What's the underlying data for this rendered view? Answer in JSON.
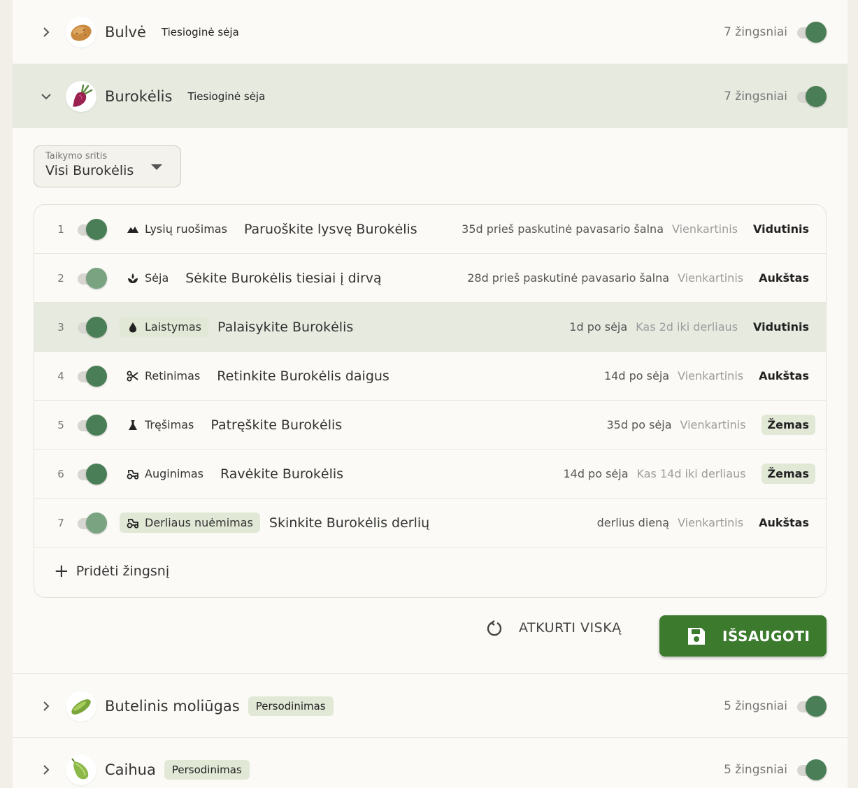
{
  "crops": [
    {
      "name": "Bulvė",
      "method": "Tiesioginė sėja",
      "steps_count": "7 žingsniai",
      "enabled": true,
      "icon": "potato-icon"
    },
    {
      "name": "Burokėlis",
      "method": "Tiesioginė sėja",
      "steps_count": "7 žingsniai",
      "enabled": true,
      "icon": "beet-icon"
    },
    {
      "name": "Butelinis moliūgas",
      "method": "Persodinimas",
      "steps_count": "5 žingsniai",
      "enabled": true,
      "icon": "bottle-gourd-icon"
    },
    {
      "name": "Caihua",
      "method": "Persodinimas",
      "steps_count": "5 žingsniai",
      "enabled": true,
      "icon": "caihua-icon"
    }
  ],
  "scope": {
    "label": "Taikymo sritis",
    "value": "Visi Burokėlis"
  },
  "steps": [
    {
      "num": "1",
      "category": "Lysių ruošimas",
      "icon": "bed-prep-icon",
      "task": "Paruoškite lysvę Burokėlis",
      "timing": "35d prieš paskutinė pavasario šalna",
      "frequency": "Vienkartinis",
      "priority": "Vidutinis"
    },
    {
      "num": "2",
      "category": "Sėja",
      "icon": "seedling-icon",
      "task": "Sėkite Burokėlis tiesiai į dirvą",
      "timing": "28d prieš paskutinė pavasario šalna",
      "frequency": "Vienkartinis",
      "priority": "Aukštas"
    },
    {
      "num": "3",
      "category": "Laistymas",
      "icon": "water-drop-icon",
      "task": "Palaisykite Burokėlis",
      "timing": "1d po sėja",
      "frequency": "Kas 2d iki derliaus",
      "priority": "Vidutinis"
    },
    {
      "num": "4",
      "category": "Retinimas",
      "icon": "scissors-icon",
      "task": "Retinkite Burokėlis daigus",
      "timing": "14d po sėja",
      "frequency": "Vienkartinis",
      "priority": "Aukštas"
    },
    {
      "num": "5",
      "category": "Tręšimas",
      "icon": "flask-icon",
      "task": "Patręškite Burokėlis",
      "timing": "35d po sėja",
      "frequency": "Vienkartinis",
      "priority": "Žemas"
    },
    {
      "num": "6",
      "category": "Auginimas",
      "icon": "tractor-icon",
      "task": "Ravėkite Burokėlis",
      "timing": "14d po sėja",
      "frequency": "Kas 14d iki derliaus",
      "priority": "Žemas"
    },
    {
      "num": "7",
      "category": "Derliaus nuėmimas",
      "icon": "tractor-icon",
      "task": "Skinkite Burokėlis derlių",
      "timing": "derlius dieną",
      "frequency": "Vienkartinis",
      "priority": "Aukštas"
    }
  ],
  "add_step_label": "Pridėti žingsnį",
  "reset_label": "ATKURTI VISKĄ",
  "save_label": "IŠSAUGOTI",
  "colors": {
    "accent": "#3c7a2e",
    "toggle_on": "#4a7e57",
    "highlight": "#e6eadf",
    "pill": "#e1e8d6"
  }
}
